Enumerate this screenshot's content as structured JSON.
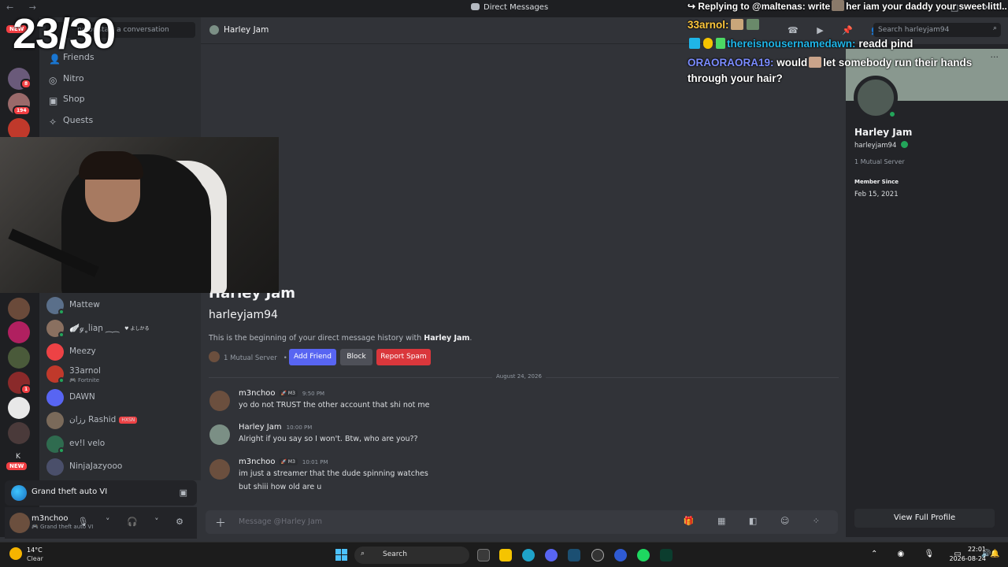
{
  "titlebar": {
    "nav": "← →",
    "title": "Direct Messages",
    "window_controls": "– □ ✕"
  },
  "overlay": {
    "counter": "23/30",
    "chat": [
      {
        "user": "",
        "text": "↪ Replying to @maltenas: write",
        "text2": "her iam your daddy your sweet littl..",
        "color": "#ffffff"
      },
      {
        "user": "33arnol:",
        "text": "",
        "color": "#ffc83d"
      },
      {
        "user": "thereisnousernamedawn:",
        "text": "readd pind",
        "color": "#1fb5e8"
      },
      {
        "user": "ORAORAORA19:",
        "text": "would",
        "text2": "let somebody run their hands",
        "color": "#7b8cff"
      },
      {
        "user": "",
        "text": "through your hair?",
        "color": "#ffffff"
      }
    ]
  },
  "rail": {
    "new_badge": "NEW",
    "badges": [
      "8",
      "194",
      "1"
    ],
    "letter": "K",
    "new_badge2": "NEW"
  },
  "sidebar": {
    "find_placeholder": "nd or start a conversation",
    "nav": [
      {
        "label": "Friends",
        "icon": "friends-icon",
        "glyph": "👤"
      },
      {
        "label": "Nitro",
        "icon": "nitro-icon",
        "glyph": "◎"
      },
      {
        "label": "Shop",
        "icon": "shop-icon",
        "glyph": "▣"
      },
      {
        "label": "Quests",
        "icon": "quests-icon",
        "glyph": "✧"
      }
    ],
    "dms": [
      {
        "name": "Mattew",
        "sub": "",
        "tag": "",
        "color": "#5a6f8a"
      },
      {
        "name": "🪽ℊ˳ᥣiaր ⁔⁔",
        "sub": "",
        "tag": "♥ よしかる",
        "color": "#8a7060"
      },
      {
        "name": "Meezy",
        "sub": "",
        "tag": "",
        "color": "#ed4245"
      },
      {
        "name": "33arnol",
        "sub": "🎮 Fortnite",
        "tag": "",
        "color": "#c0392b"
      },
      {
        "name": "DAWN",
        "sub": "",
        "tag": "",
        "color": "#5865f2"
      },
      {
        "name": "رزان Rashid",
        "sub": "",
        "tag": "HXSN",
        "color": "#7a6a5a"
      },
      {
        "name": "ev!l velo",
        "sub": "",
        "tag": "",
        "color": "#2f6b4f"
      },
      {
        "name": "NinjaJazyooo",
        "sub": "",
        "tag": "",
        "color": "#4a4f6a"
      }
    ]
  },
  "activity": {
    "game": "Grand theft auto VI"
  },
  "user": {
    "name": "m3nchoo",
    "status": "🎮 Grand theft auto VI",
    "controls": "🎙 ˅ 🎧 ˅ ⚙"
  },
  "chat": {
    "header_name": "Harley Jam",
    "header_tools": "☎ ▶ 📌 👥 ◉",
    "search_placeholder": "Search harleyjam94",
    "intro_name": "Harley Jam",
    "intro_username": "harleyjam94",
    "intro_text_prefix": "This is the beginning of your direct message history with ",
    "intro_text_name": "Harley Jam",
    "intro_text_suffix": ".",
    "mutual": "1 Mutual Server",
    "buttons": {
      "add_friend": "Add Friend",
      "block": "Block",
      "report": "Report Spam"
    },
    "date_divider": "August 24, 2026",
    "messages": [
      {
        "author": "m3nchoo",
        "tag": "🚀 M3",
        "time": "9:50 PM",
        "lines": [
          "yo do not TRUST  the other account that shi not me"
        ],
        "color": "#6b4f3e"
      },
      {
        "author": "Harley Jam",
        "tag": "",
        "time": "10:00 PM",
        "lines": [
          "Alright if you say so I won't. Btw, who are you??"
        ],
        "color": "#7b8f85"
      },
      {
        "author": "m3nchoo",
        "tag": "🚀 M3",
        "time": "10:01 PM",
        "lines": [
          "im just a streamer that the dude spinning watches",
          "but shiii how old are u"
        ],
        "color": "#6b4f3e"
      }
    ],
    "composer_placeholder": "Message @Harley Jam",
    "composer_tools": "🎁 ▦ ◧ ☺ ⁘"
  },
  "profile": {
    "name": "Harley Jam",
    "username": "harleyjam94",
    "mutual": "1 Mutual Server",
    "member_since_label": "Member Since",
    "member_since": "Feb 15, 2021",
    "view_full": "View Full Profile",
    "menu": "···"
  },
  "taskbar": {
    "temp": "14°C",
    "condition": "Clear",
    "search": "Search",
    "tray": "⌃ ◉ 🎙 ▭ 🔊",
    "time": "22:01",
    "date": "2026-08-24",
    "bell": "🔔"
  },
  "colors": {
    "accent": "#5865f2",
    "danger": "#da373c",
    "online": "#23a55a",
    "background": "#313338"
  }
}
